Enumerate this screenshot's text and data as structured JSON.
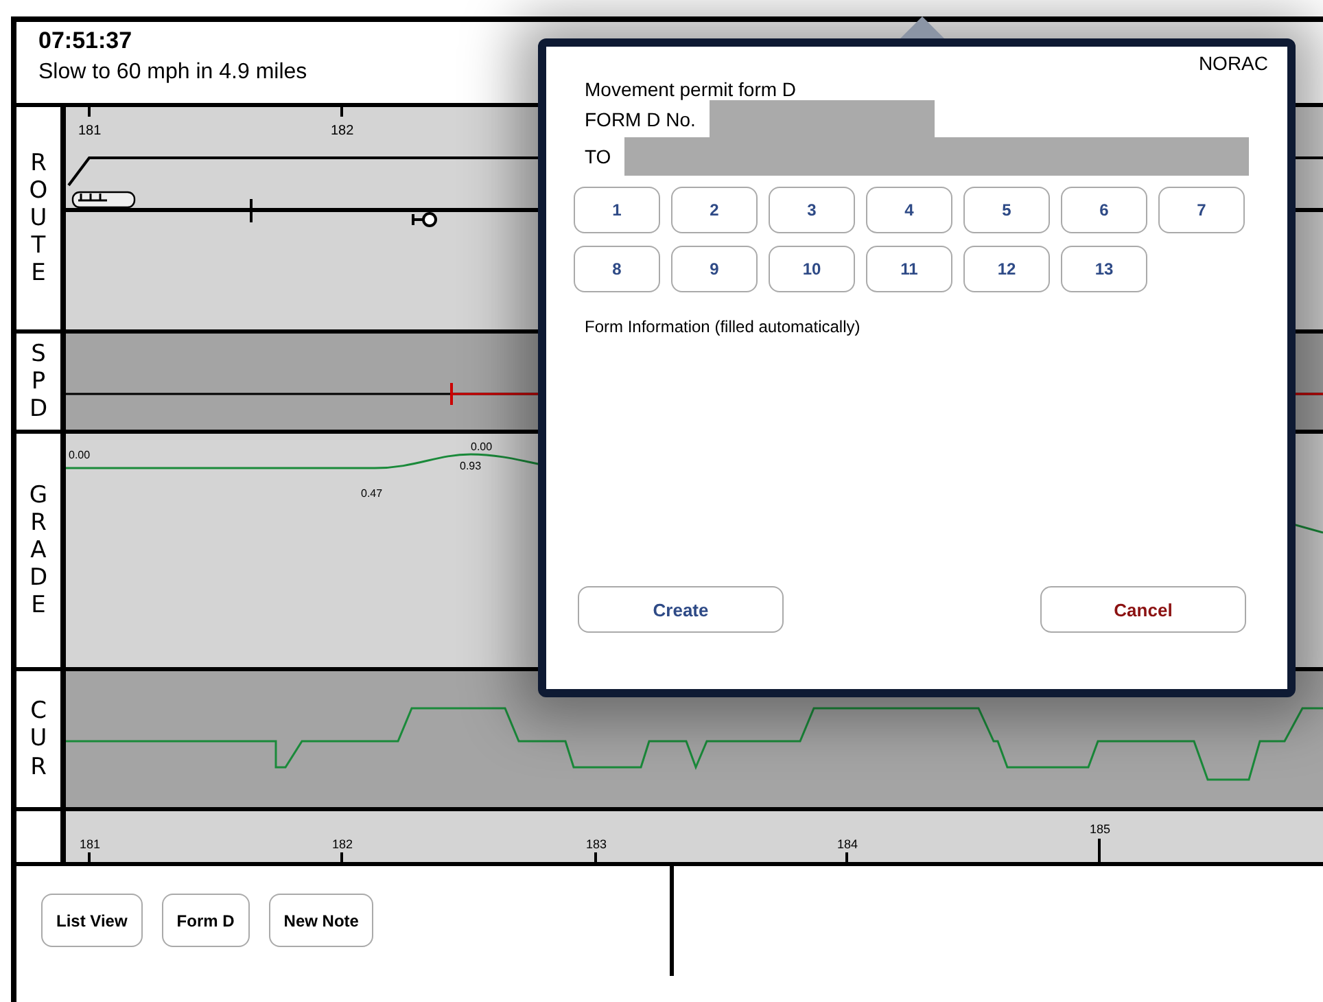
{
  "header": {
    "time": "07:51:37",
    "message": "Slow to 60 mph in 4.9 miles"
  },
  "tracks": [
    {
      "kind": "route",
      "label": "ROUTE",
      "mileposts": [
        "181",
        "182"
      ]
    },
    {
      "kind": "speed",
      "label": "SPD"
    },
    {
      "kind": "grade",
      "label": "GRADE",
      "values": [
        "0.00",
        "0.47",
        "0.00",
        "0.93"
      ]
    },
    {
      "kind": "curve",
      "label": "CUR"
    },
    {
      "kind": "axis",
      "mileposts": [
        "181",
        "182",
        "183",
        "184",
        "185"
      ]
    }
  ],
  "buttons": [
    "List View",
    "Form D",
    "New Note"
  ],
  "dialog": {
    "badge": "NORAC",
    "title": "Movement permit form D",
    "fields": [
      {
        "label": "FORM D No."
      },
      {
        "label": "TO"
      }
    ],
    "number_buttons": [
      "1",
      "2",
      "3",
      "4",
      "5",
      "6",
      "7",
      "8",
      "9",
      "10",
      "11",
      "12",
      "13"
    ],
    "info": "Form Information (filled automatically)",
    "actions": [
      {
        "label": "Create",
        "kind": "confirm"
      },
      {
        "label": "Cancel",
        "kind": "cancel"
      }
    ]
  }
}
